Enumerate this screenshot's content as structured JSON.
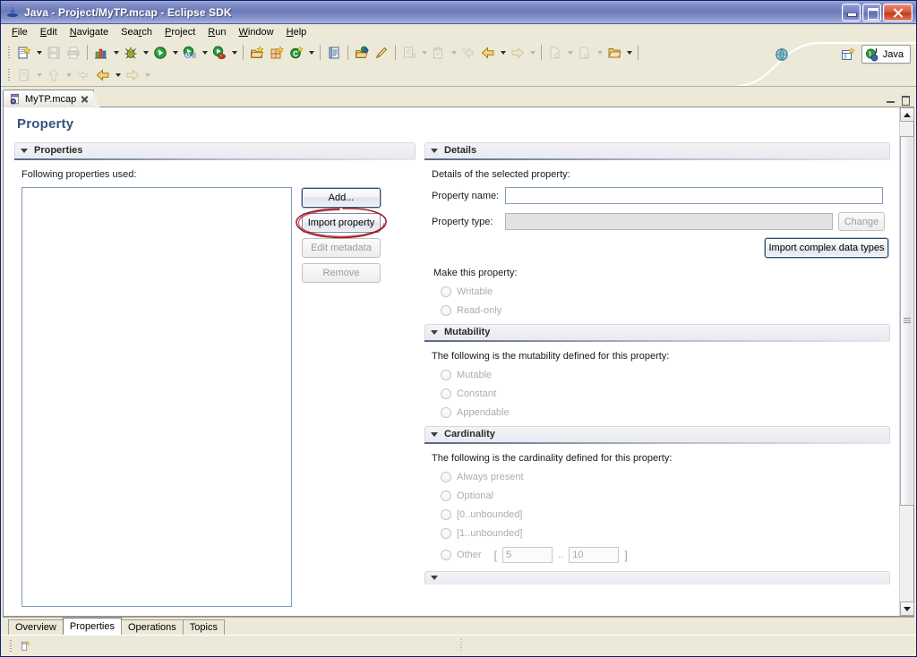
{
  "window": {
    "title": "Java - Project/MyTP.mcap - Eclipse SDK",
    "app_icon": "eclipse-java-icon",
    "minimize_label": "Minimize",
    "maximize_label": "Maximize",
    "close_label": "Close"
  },
  "menubar": {
    "items": [
      {
        "label": "File",
        "mnemonic": "F"
      },
      {
        "label": "Edit",
        "mnemonic": "E"
      },
      {
        "label": "Navigate",
        "mnemonic": "N"
      },
      {
        "label": "Search",
        "mnemonic": "r"
      },
      {
        "label": "Project",
        "mnemonic": "P"
      },
      {
        "label": "Run",
        "mnemonic": "R"
      },
      {
        "label": "Window",
        "mnemonic": "W"
      },
      {
        "label": "Help",
        "mnemonic": "H"
      }
    ]
  },
  "toolbar": {
    "row1": [
      {
        "icon": "new-wizard-icon",
        "tooltip": "New",
        "arrow": true,
        "enabled": true
      },
      {
        "icon": "save-icon",
        "tooltip": "Save",
        "arrow": false,
        "enabled": false
      },
      {
        "icon": "print-icon",
        "tooltip": "Print",
        "arrow": false,
        "enabled": false
      },
      {
        "icon": "build-all-icon",
        "tooltip": "Build",
        "arrow": true,
        "enabled": true
      },
      {
        "icon": "debug-bug-icon",
        "tooltip": "Debug",
        "arrow": true,
        "enabled": true
      },
      {
        "icon": "run-icon",
        "tooltip": "Run",
        "arrow": true,
        "enabled": true
      },
      {
        "icon": "run-history-icon",
        "tooltip": "Run History",
        "arrow": true,
        "enabled": true
      },
      {
        "icon": "run-external-icon",
        "tooltip": "External Tools",
        "arrow": true,
        "enabled": true
      },
      {
        "icon": "new-java-project-icon",
        "tooltip": "New Java Project",
        "arrow": false,
        "enabled": true
      },
      {
        "icon": "new-package-icon",
        "tooltip": "New Package",
        "arrow": false,
        "enabled": true
      },
      {
        "icon": "new-class-icon",
        "tooltip": "New Class",
        "arrow": true,
        "enabled": true
      },
      {
        "icon": "open-task-icon",
        "tooltip": "Open Task",
        "arrow": false,
        "enabled": true
      },
      {
        "icon": "open-type-icon",
        "tooltip": "Open Type",
        "arrow": false,
        "enabled": true
      },
      {
        "icon": "search-pencil-icon",
        "tooltip": "Search",
        "arrow": false,
        "enabled": true
      },
      {
        "icon": "next-annotation-icon",
        "tooltip": "Next Annotation",
        "arrow": true,
        "enabled": false
      },
      {
        "icon": "prev-annotation-icon",
        "tooltip": "Previous Annotation",
        "arrow": true,
        "enabled": false
      },
      {
        "icon": "folder-annotation-icon",
        "tooltip": "Annotation",
        "arrow": true,
        "enabled": true
      }
    ],
    "row2": [
      {
        "icon": "new-note-icon",
        "tooltip": "New Note",
        "arrow": true,
        "enabled": false
      },
      {
        "icon": "up-arrow-icon",
        "tooltip": "Up",
        "arrow": true,
        "enabled": false
      },
      {
        "icon": "back-dim-icon",
        "tooltip": "Back",
        "arrow": false,
        "enabled": false
      },
      {
        "icon": "back-icon",
        "tooltip": "Back",
        "arrow": true,
        "enabled": true
      },
      {
        "icon": "forward-icon",
        "tooltip": "Forward",
        "arrow": true,
        "enabled": false
      }
    ],
    "web_browser_icon": "web-browser-icon"
  },
  "perspective": {
    "open_perspective_icon": "open-perspective-icon",
    "current": "Java",
    "current_icon": "java-perspective-icon"
  },
  "editor": {
    "tab_label": "MyTP.mcap",
    "tab_icon": "mcap-file-icon",
    "close_icon": "close-icon",
    "minimize_icon": "minimize-icon",
    "maximize_icon": "maximize-icon"
  },
  "form": {
    "title": "Property",
    "properties_section": {
      "title": "Properties",
      "description": "Following properties used:",
      "list_items": [],
      "buttons": [
        {
          "label": "Add...",
          "enabled": true,
          "focused": true
        },
        {
          "label": "Import property",
          "enabled": true,
          "focused": false
        },
        {
          "label": "Edit metadata",
          "enabled": false,
          "focused": false
        },
        {
          "label": "Remove",
          "enabled": false,
          "focused": false
        }
      ]
    },
    "details_section": {
      "title": "Details",
      "description": "Details of the selected property:",
      "property_name_label": "Property name:",
      "property_name_value": "",
      "property_type_label": "Property type:",
      "property_type_value": "",
      "change_button": "Change",
      "import_complex_button": "Import complex data types",
      "make_property_label": "Make this property:",
      "radios": [
        {
          "label": "Writable",
          "selected": false,
          "enabled": false
        },
        {
          "label": "Read-only",
          "selected": false,
          "enabled": false
        }
      ]
    },
    "mutability_section": {
      "title": "Mutability",
      "description": "The following is the mutability defined for this property:",
      "radios": [
        {
          "label": "Mutable",
          "selected": false,
          "enabled": false
        },
        {
          "label": "Constant",
          "selected": false,
          "enabled": false
        },
        {
          "label": "Appendable",
          "selected": false,
          "enabled": false
        }
      ]
    },
    "cardinality_section": {
      "title": "Cardinality",
      "description": "The following is the cardinality defined for this property:",
      "radios": [
        {
          "label": "Always present",
          "selected": false,
          "enabled": false
        },
        {
          "label": "Optional",
          "selected": false,
          "enabled": false
        },
        {
          "label": "[0..unbounded]",
          "selected": false,
          "enabled": false
        },
        {
          "label": "[1..unbounded]",
          "selected": false,
          "enabled": false
        }
      ],
      "other_label": "Other",
      "bracket_open": "[",
      "bracket_close": "]",
      "range_separator": "..",
      "min_value": "5",
      "max_value": "10"
    }
  },
  "page_tabs": [
    {
      "label": "Overview",
      "selected": false
    },
    {
      "label": "Properties",
      "selected": true
    },
    {
      "label": "Operations",
      "selected": false
    },
    {
      "label": "Topics",
      "selected": false
    }
  ],
  "status_bar": {
    "icon": "new-element-status-icon",
    "message": ""
  },
  "annotation": {
    "type": "hand-drawn-ellipse",
    "color": "#a01822",
    "target": "Import property"
  },
  "scrollbar": {
    "up_arrow": "scroll-up-arrow",
    "down_arrow": "scroll-down-arrow",
    "thumb_top_pct": 3,
    "thumb_height_pct": 77
  }
}
